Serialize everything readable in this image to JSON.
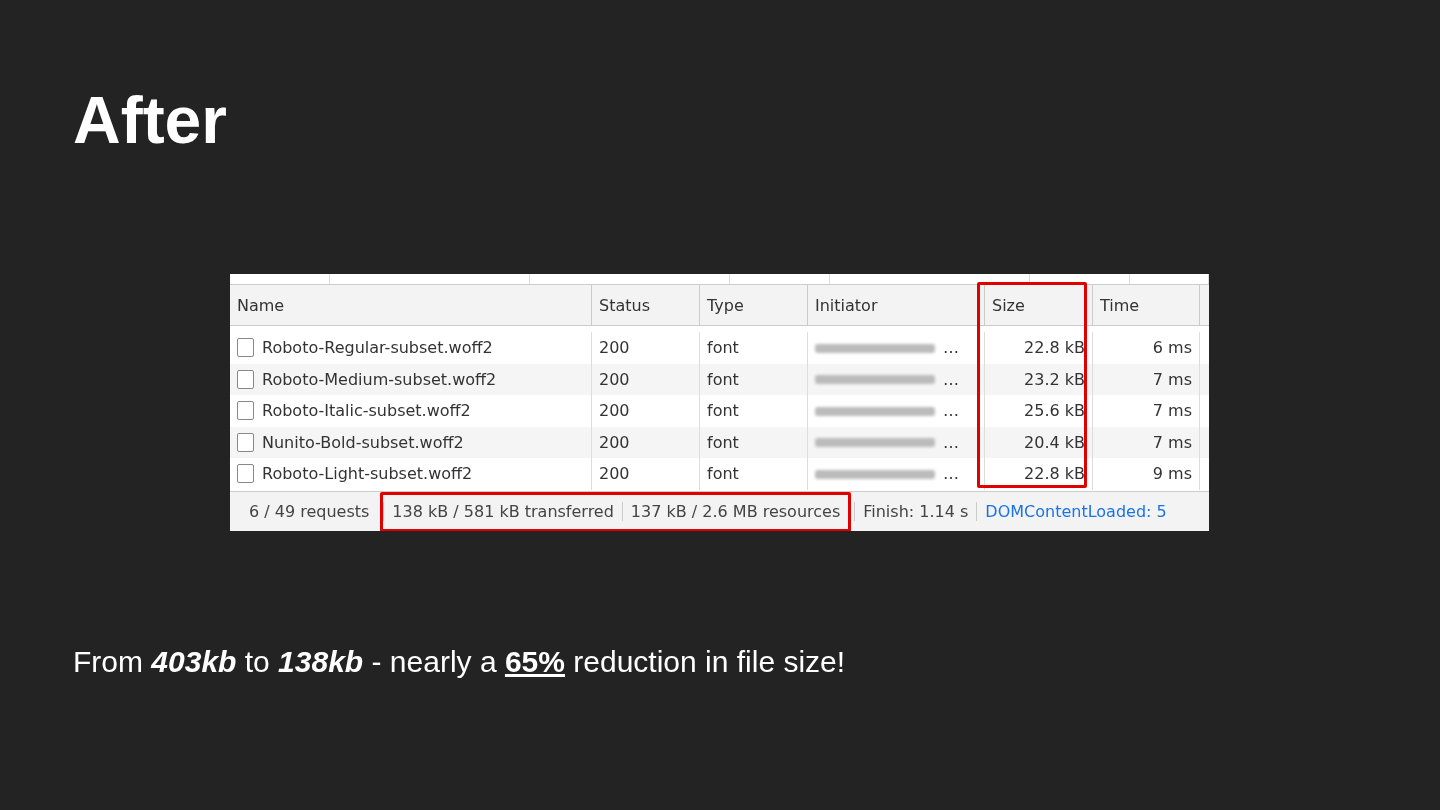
{
  "slide": {
    "title": "After"
  },
  "network_panel": {
    "columns": [
      {
        "label": "Name",
        "highlighted": false
      },
      {
        "label": "Status",
        "highlighted": false
      },
      {
        "label": "Type",
        "highlighted": false
      },
      {
        "label": "Initiator",
        "highlighted": false
      },
      {
        "label": "Size",
        "highlighted": true
      },
      {
        "label": "Time",
        "highlighted": false
      }
    ],
    "rows": [
      {
        "name": "Roboto-Regular-subset.woff2",
        "checked": false,
        "status": "200",
        "type": "font",
        "initiator": "…",
        "size": "22.8 kB",
        "time": "6 ms"
      },
      {
        "name": "Roboto-Medium-subset.woff2",
        "checked": false,
        "status": "200",
        "type": "font",
        "initiator": "…",
        "size": "23.2 kB",
        "time": "7 ms"
      },
      {
        "name": "Roboto-Italic-subset.woff2",
        "checked": false,
        "status": "200",
        "type": "font",
        "initiator": "…",
        "size": "25.6 kB",
        "time": "7 ms"
      },
      {
        "name": "Nunito-Bold-subset.woff2",
        "checked": false,
        "status": "200",
        "type": "font",
        "initiator": "…",
        "size": "20.4 kB",
        "time": "7 ms"
      },
      {
        "name": "Roboto-Light-subset.woff2",
        "checked": false,
        "status": "200",
        "type": "font",
        "initiator": "…",
        "size": "22.8 kB",
        "time": "9 ms"
      }
    ],
    "status_bar": [
      {
        "text": "6 / 49 requests",
        "kind": "plain",
        "highlighted": false
      },
      {
        "text": "138 kB / 581 kB transferred",
        "kind": "plain",
        "highlighted": true
      },
      {
        "text": "137 kB / 2.6 MB resources",
        "kind": "plain",
        "highlighted": true
      },
      {
        "text": "Finish: 1.14 s",
        "kind": "plain",
        "highlighted": false
      },
      {
        "text": "DOMContentLoaded: 5",
        "kind": "link",
        "highlighted": false
      }
    ]
  },
  "caption": [
    {
      "text": "From ",
      "kind": "plain"
    },
    {
      "text": "403kb",
      "kind": "emphasis"
    },
    {
      "text": " to ",
      "kind": "plain"
    },
    {
      "text": "138kb",
      "kind": "emphasis"
    },
    {
      "text": " - nearly a ",
      "kind": "plain"
    },
    {
      "text": "65%",
      "kind": "highlight"
    },
    {
      "text": " reduction in file size!",
      "kind": "plain"
    }
  ]
}
